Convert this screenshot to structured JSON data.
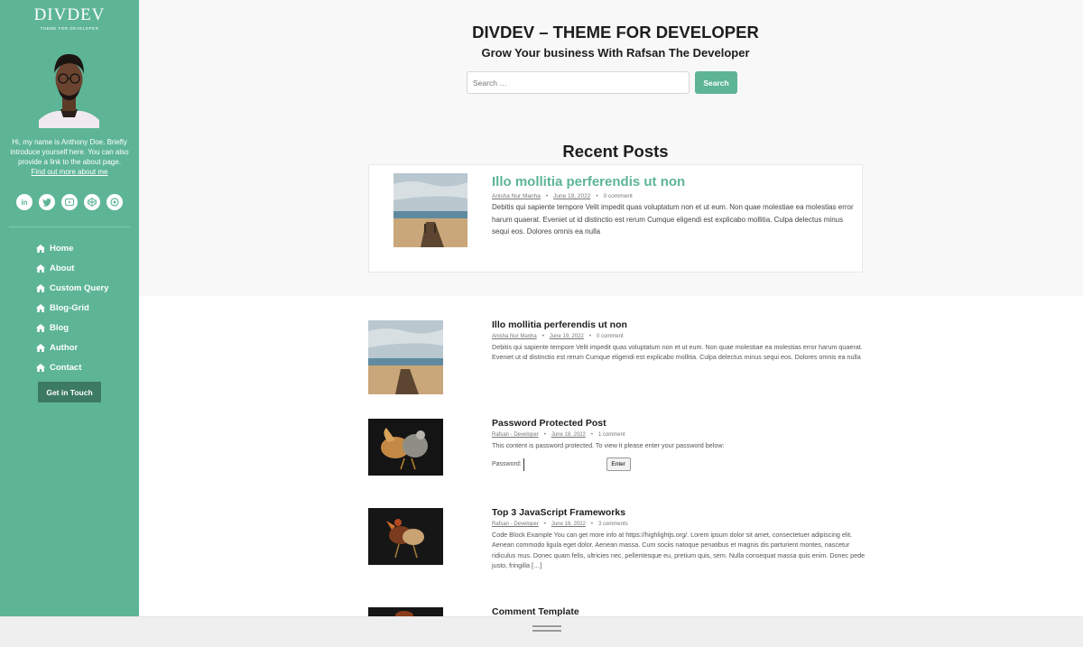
{
  "sidebar": {
    "logo_title": "DIVDEV",
    "logo_sub": "THEME FOR DEVELOPER",
    "bio": "Hi, my name is Anthony Doe. Briefly introduce yourself here. You can also provide a link to the about page.",
    "bio_link": "Find out more about me",
    "social_icons": [
      "linkedin-icon",
      "twitter-icon",
      "youtube-icon",
      "codepen-icon",
      "stackoverflow-icon"
    ],
    "nav": [
      {
        "label": "Home",
        "icon": "home-icon"
      },
      {
        "label": "About",
        "icon": "home-icon"
      },
      {
        "label": "Custom Query",
        "icon": "home-icon"
      },
      {
        "label": "Blog-Grid",
        "icon": "home-icon"
      },
      {
        "label": "Blog",
        "icon": "home-icon"
      },
      {
        "label": "Author",
        "icon": "home-icon"
      },
      {
        "label": "Contact",
        "icon": "home-icon"
      }
    ],
    "cta": "Get in Touch"
  },
  "header": {
    "title": "DIVDEV – THEME FOR DEVELOPER",
    "tagline": "Grow Your business With Rafsan The Developer",
    "search_placeholder": "Search …",
    "search_button": "Search",
    "recent_title": "Recent Posts"
  },
  "featured": {
    "title": "Illo mollitia perferendis ut non",
    "author": "Anisha Nur Manha",
    "date": "June 19, 2022",
    "comments": "0 comment",
    "excerpt": "Debitis qui sapiente tempore Velit impedit quas voluptatum non et ut eum. Non quae molestiae ea molestias error harum quaerat. Eveniet ut id distinctio est rerum Cumque eligendi est explicabo mollitia. Culpa delectus minus sequi eos. Dolores omnis ea nulla"
  },
  "posts": [
    {
      "title": "Illo mollitia perferendis ut non",
      "author": "Anisha Nur Manha",
      "date": "June 19, 2022",
      "comments": "0 comment",
      "excerpt": "Debitis qui sapiente tempore Velit impedit quas voluptatum non et ut eum. Non quae molestiae ea molestias error harum quaerat. Eveniet ut id distinctio est rerum Cumque eligendi est explicabo mollitia. Culpa delectus minus sequi eos. Dolores omnis ea nulla"
    },
    {
      "title": "Password Protected Post",
      "author": "Rafsan - Developer",
      "date": "June 18, 2022",
      "comments": "1 comment",
      "excerpt": "This content is password protected. To view it please enter your password below:",
      "password_label": "Password:",
      "enter_button": "Enter"
    },
    {
      "title": "Top 3 JavaScript Frameworks",
      "author": "Rafsan - Developer",
      "date": "June 18, 2022",
      "comments": "3 comments",
      "excerpt": "Code Block Example You can get more info at https://highlightjs.org/. Lorem ipsum dolor sit amet, consectetuer adipiscing elit. Aenean commodo ligula eget dolor. Aenean massa. Cum sociis natoque penatibus et magnis dis parturient montes, nascetur ridiculus mus. Donec quam felis, ultricies nec, pellentesque eu, pretium quis, sem. Nulla consequat massa quis enim. Donec pede justo, fringilla […]"
    },
    {
      "title": "Comment Template"
    }
  ],
  "colors": {
    "accent": "#5db596",
    "accent_dark": "#3d7a64",
    "hero_bg": "#f8f8f8"
  }
}
